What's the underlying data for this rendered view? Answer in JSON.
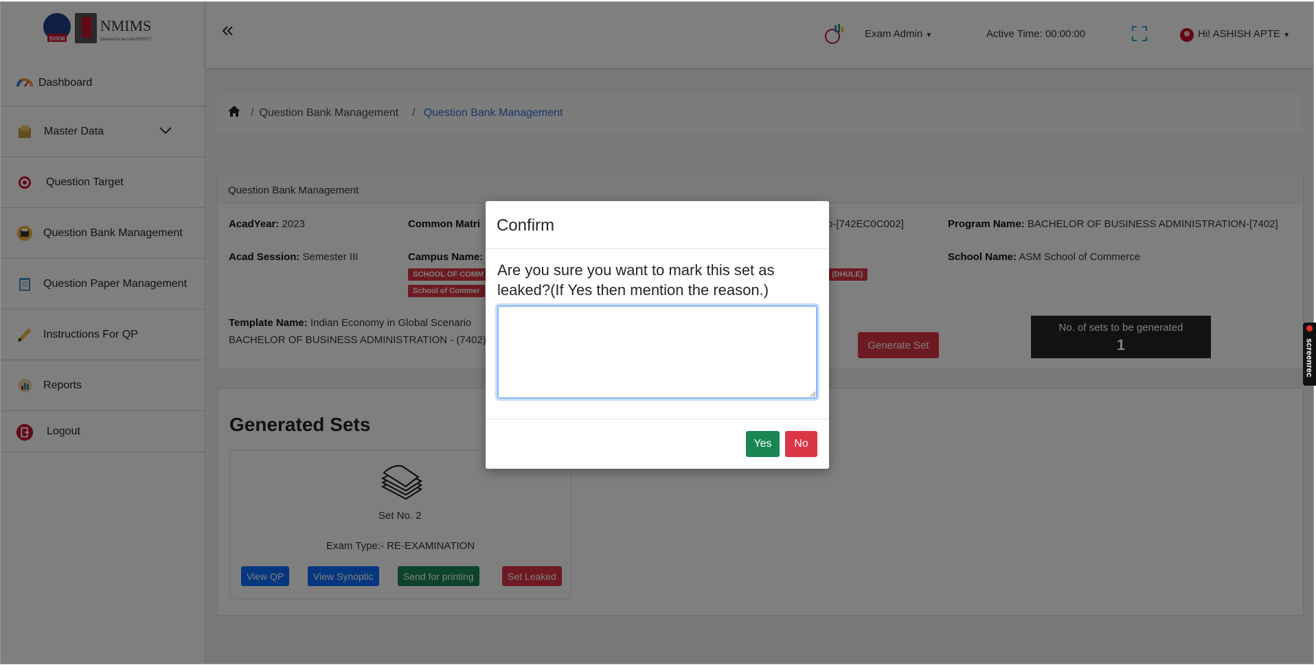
{
  "logo": {
    "svkm": "SVKM",
    "brand": "NMIMS",
    "tagline": "Deemed to be UNIVERSITY"
  },
  "sidebar": {
    "items": [
      {
        "label": "Dashboard",
        "icon": "speedometer-icon"
      },
      {
        "label": "Master Data",
        "icon": "folder-icon"
      },
      {
        "label": "Question Target",
        "icon": "target-icon"
      },
      {
        "label": "Question Bank Management",
        "icon": "printer-icon"
      },
      {
        "label": "Question Paper Management",
        "icon": "notepad-icon"
      },
      {
        "label": "Instructions For QP",
        "icon": "pencil-icon"
      },
      {
        "label": "Reports",
        "icon": "chart-icon"
      },
      {
        "label": "Logout",
        "icon": "logout-icon"
      }
    ]
  },
  "header": {
    "role": "Exam Admin",
    "active_time": "Active Time: 00:00:00",
    "greeting": "Hi! ASHISH APTE"
  },
  "breadcrumb": {
    "level1": "Question Bank Management",
    "current": "Question Bank Management",
    "separator": "/"
  },
  "info": {
    "card_title": "Question Bank Management",
    "acadyear_label": "AcadYear:",
    "acadyear_value": "2023",
    "common_label": "Common Matri",
    "course_fragment": "o-[742EC0C002]",
    "program_label": "Program Name:",
    "program_value": "BACHELOR OF BUSINESS ADMINISTRATION-[7402]",
    "session_label": "Acad Session:",
    "session_value": "Semester III",
    "campus_label": "Campus Name:",
    "tag1": "SCHOOL OF COMM",
    "tag2": "School of Commer",
    "tag3": "(DHULE)",
    "school_label": "School Name:",
    "school_value": "ASM School of Commerce",
    "template_label": "Template Name:",
    "template_value": "Indian Economy in Global Scenario",
    "template_program": "BACHELOR OF BUSINESS ADMINISTRATION - (7402)",
    "generate_label": "Generate Set",
    "sets_label": "No. of sets to be generated",
    "sets_value": "1"
  },
  "generated": {
    "title": "Generated Sets",
    "set_no": "Set No. 2",
    "exam_type": "Exam Type:- RE-EXAMINATION",
    "buttons": {
      "view_qp": "View QP",
      "view_synoptic": "View Synoptic",
      "send_printing": "Send for printing",
      "set_leaked": "Set Leaked"
    }
  },
  "modal": {
    "title": "Confirm",
    "question": "Are you sure you want to mark this set as leaked?(If Yes then mention the reason.)",
    "reason_value": "",
    "yes_label": "Yes",
    "no_label": "No"
  },
  "screenrec": {
    "label": "screenrec"
  },
  "colors": {
    "primary": "#0d6efd",
    "danger": "#dc3545",
    "success": "#198754",
    "dark": "#212529",
    "link": "#2f6fd6"
  }
}
